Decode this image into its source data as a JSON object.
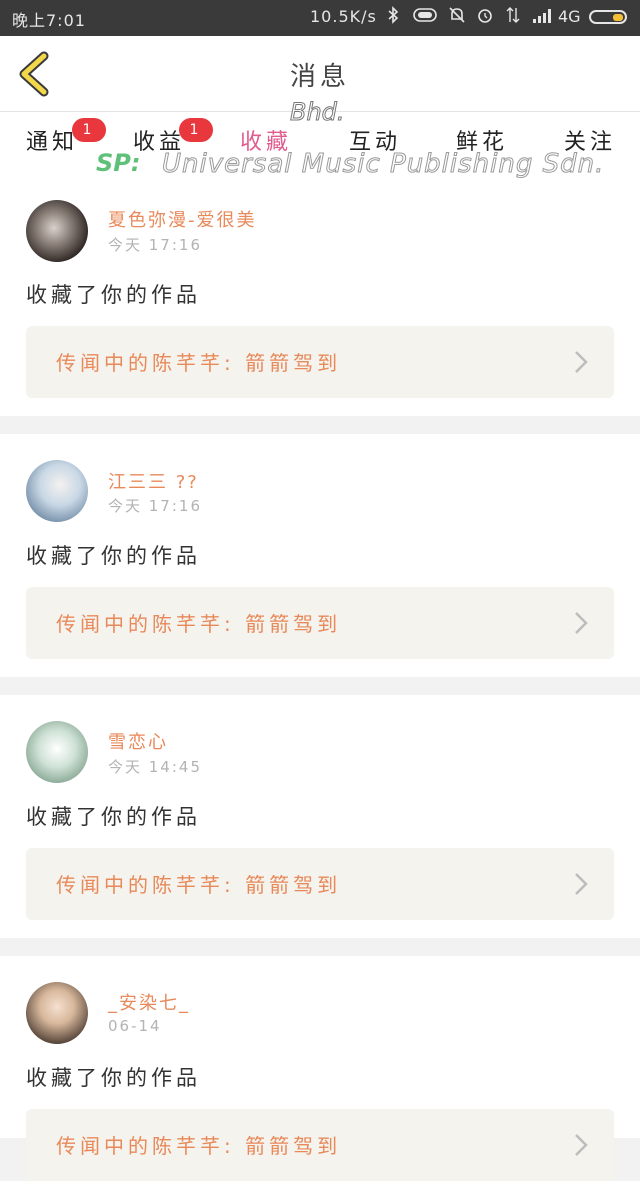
{
  "status_bar": {
    "time": "晚上7:01",
    "speed": "10.5K/s",
    "network": "4G",
    "icons": [
      "bluetooth-icon",
      "vibrate-icon",
      "mute-icon",
      "alarm-icon",
      "data-arrows-icon",
      "signal-icon"
    ]
  },
  "header": {
    "title": "消息",
    "back_icon": "chevron-left-icon"
  },
  "tabs": [
    {
      "label": "通知",
      "badge": "1",
      "active": false
    },
    {
      "label": "收益",
      "badge": "1",
      "active": false
    },
    {
      "label": "收藏",
      "badge": "",
      "active": true
    },
    {
      "label": "互动",
      "badge": "",
      "active": false
    },
    {
      "label": "鲜花",
      "badge": "",
      "active": false
    },
    {
      "label": "关注",
      "badge": "",
      "active": false
    }
  ],
  "watermark": {
    "sp": "SP:",
    "text": "Universal Music Publishing Sdn.",
    "bhd": "Bhd."
  },
  "colors": {
    "accent": "#e8895a",
    "active_tab": "#e05c8e",
    "badge": "#e8383d",
    "box_bg": "#f4f3ee"
  },
  "items": [
    {
      "username": "夏色弥漫-爱很美",
      "time": "今天 17:16",
      "action": "收藏了你的作品",
      "work": "传闻中的陈芊芊: 箭箭驾到"
    },
    {
      "username": "江三三 ??",
      "time": "今天 17:16",
      "action": "收藏了你的作品",
      "work": "传闻中的陈芊芊: 箭箭驾到"
    },
    {
      "username": "雪恋心",
      "time": "今天 14:45",
      "action": "收藏了你的作品",
      "work": "传闻中的陈芊芊: 箭箭驾到"
    },
    {
      "username": "_安染七_",
      "time": "06-14",
      "action": "收藏了你的作品",
      "work": "传闻中的陈芊芊: 箭箭驾到"
    }
  ]
}
